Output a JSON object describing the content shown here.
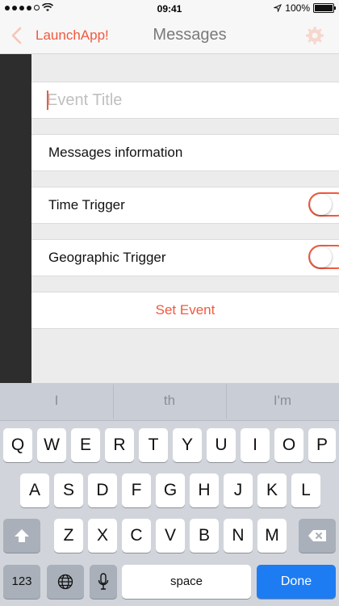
{
  "status_bar": {
    "time": "09:41",
    "battery": "100%"
  },
  "nav": {
    "back_label": "LaunchApp!",
    "title": "Messages"
  },
  "form": {
    "event_title_placeholder": "Event Title",
    "messages_info_label": "Messages information",
    "time_trigger_label": "Time Trigger",
    "geo_trigger_label": "Geographic Trigger",
    "set_event_label": "Set Event"
  },
  "keyboard": {
    "predictions": [
      "I",
      "th",
      "I'm"
    ],
    "row1": [
      "Q",
      "W",
      "E",
      "R",
      "T",
      "Y",
      "U",
      "I",
      "O",
      "P"
    ],
    "row2": [
      "A",
      "S",
      "D",
      "F",
      "G",
      "H",
      "J",
      "K",
      "L"
    ],
    "row3": [
      "Z",
      "X",
      "C",
      "V",
      "B",
      "N",
      "M"
    ],
    "numbers_label": "123",
    "space_label": "space",
    "done_label": "Done"
  },
  "colors": {
    "accent": "#f05a3f",
    "done_blue": "#1e7cf2"
  }
}
